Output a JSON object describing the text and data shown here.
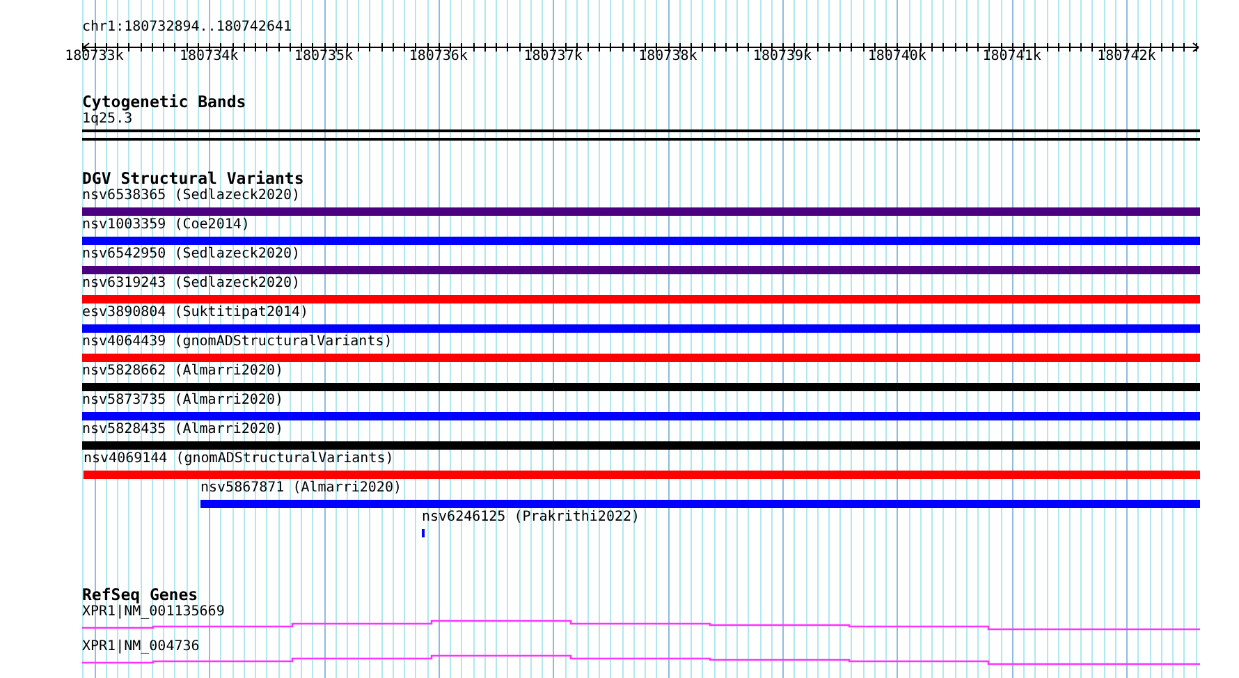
{
  "location": "chr1:180732894..180742641",
  "ruler": {
    "ticks": [
      "180733k",
      "180734k",
      "180735k",
      "180736k",
      "180737k",
      "180738k",
      "180739k",
      "180740k",
      "180741k",
      "180742k"
    ]
  },
  "tracks": [
    {
      "kind": "cytoband",
      "title": "Cytogenetic Bands",
      "features": [
        {
          "name": "1q25.3"
        }
      ]
    },
    {
      "kind": "variants",
      "title": "DGV Structural Variants",
      "features": [
        {
          "name": "nsv6538365 (Sedlazeck2020)",
          "color": "#4b0082"
        },
        {
          "name": "nsv1003359 (Coe2014)",
          "color": "#0000ff"
        },
        {
          "name": "nsv6542950 (Sedlazeck2020)",
          "color": "#4b0082"
        },
        {
          "name": "nsv6319243 (Sedlazeck2020)",
          "color": "#ff0000"
        },
        {
          "name": "esv3890804 (Suktitipat2014)",
          "color": "#0000ff"
        },
        {
          "name": "nsv4064439 (gnomADStructuralVariants)",
          "color": "#ff0000"
        },
        {
          "name": "nsv5828662 (Almarri2020)",
          "color": "#000000"
        },
        {
          "name": "nsv5873735 (Almarri2020)",
          "color": "#0000ff"
        },
        {
          "name": "nsv5828435 (Almarri2020)",
          "color": "#000000"
        },
        {
          "name": "nsv4069144 (gnomADStructuralVariants)",
          "color": "#ff0000"
        },
        {
          "name": "nsv5867871 (Almarri2020)",
          "color": "#0000ff"
        },
        {
          "name": "nsv6246125 (Prakrithi2022)",
          "color": "#0000ff"
        }
      ]
    },
    {
      "kind": "genes",
      "title": "RefSeq Genes",
      "features": [
        {
          "name": "XPR1|NM_001135669"
        },
        {
          "name": "XPR1|NM_004736"
        }
      ]
    }
  ]
}
